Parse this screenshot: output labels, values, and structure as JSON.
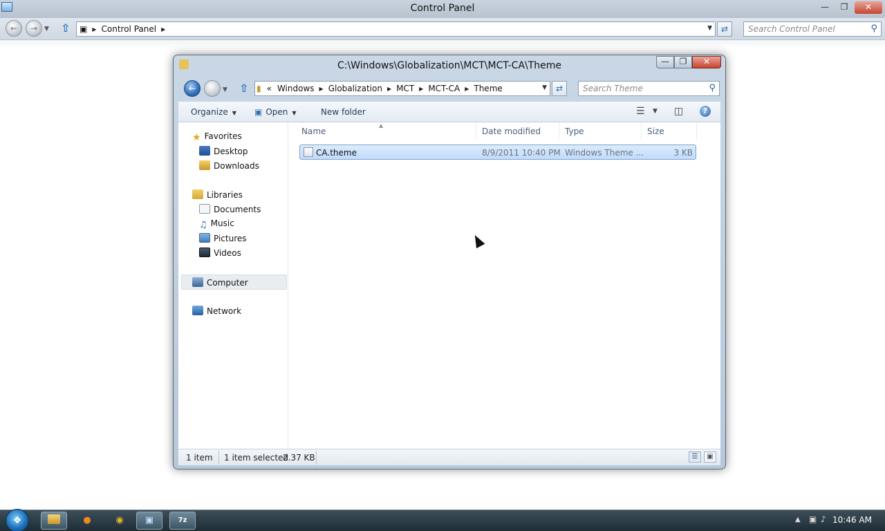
{
  "control_panel": {
    "title": "Control Panel",
    "address": [
      "Control Panel"
    ],
    "search_placeholder": "Search Control Panel"
  },
  "explorer": {
    "title": "C:\\Windows\\Globalization\\MCT\\MCT-CA\\Theme",
    "address": {
      "prefix": "«",
      "crumbs": [
        "Windows",
        "Globalization",
        "MCT",
        "MCT-CA",
        "Theme"
      ]
    },
    "search_placeholder": "Search Theme",
    "toolbar": {
      "organize": "Organize",
      "open": "Open",
      "new_folder": "New folder"
    },
    "nav": {
      "favorites": "Favorites",
      "desktop": "Desktop",
      "downloads": "Downloads",
      "libraries": "Libraries",
      "documents": "Documents",
      "music": "Music",
      "pictures": "Pictures",
      "videos": "Videos",
      "computer": "Computer",
      "network": "Network"
    },
    "columns": {
      "name": "Name",
      "date_modified": "Date modified",
      "type": "Type",
      "size": "Size"
    },
    "files": [
      {
        "name": "CA.theme",
        "date_modified": "8/9/2011 10:40 PM",
        "type": "Windows Theme ...",
        "size": "3 KB"
      }
    ],
    "status": {
      "count": "1 item",
      "selected": "1 item selected",
      "selected_size": "2.37 KB"
    }
  },
  "taskbar": {
    "clock": "10:46 AM",
    "apps": [
      "explorer-icon",
      "firefox-icon",
      "chrome-icon",
      "control-panel-icon",
      "7zip-icon"
    ]
  },
  "colors": {
    "selection": "#c1dcfc",
    "taskbar": "#1f2d35",
    "window_frame": "#b7c8da"
  }
}
